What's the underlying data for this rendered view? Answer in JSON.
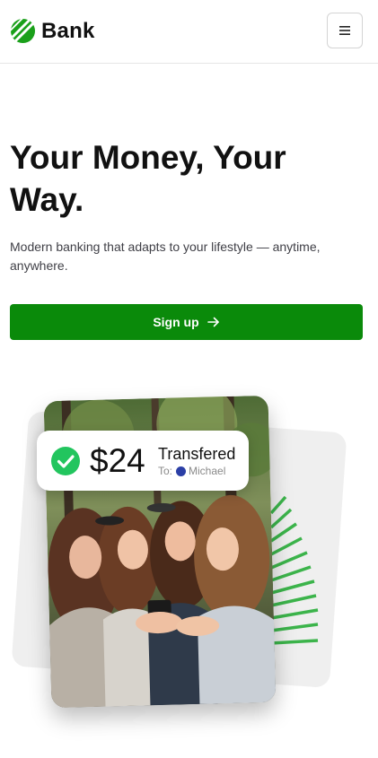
{
  "header": {
    "brand": "Bank",
    "menu_icon": "hamburger-icon"
  },
  "hero": {
    "title": "Your Money, Your Way.",
    "subtitle": "Modern banking that adapts to your lifestyle — anytime, anywhere.",
    "cta_label": "Sign up",
    "cta_icon": "arrow-right-icon"
  },
  "transfer_toast": {
    "status_icon": "check-circle-icon",
    "amount": "$24",
    "label": "Transfered",
    "to_prefix": "To:",
    "recipient": "Michael"
  },
  "colors": {
    "brand_green": "#0a8a0a",
    "check_green": "#22c55e",
    "stripe_green": "#3cb44b"
  }
}
